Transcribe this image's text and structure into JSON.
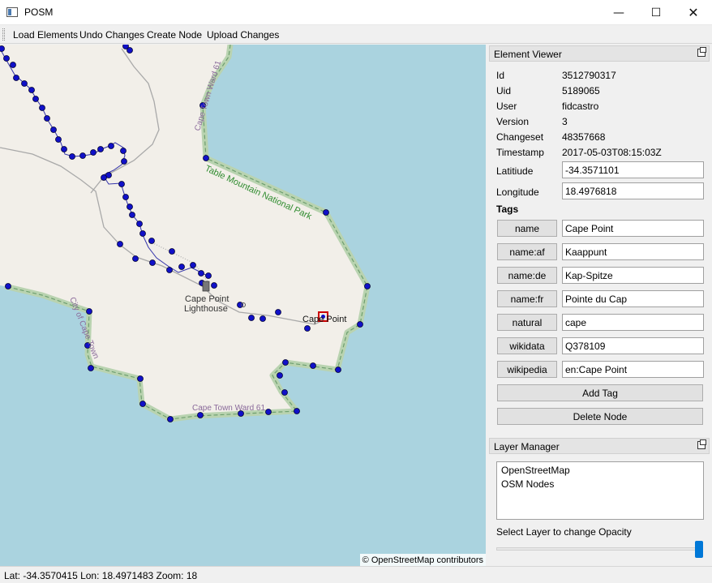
{
  "window": {
    "title": "POSM",
    "minimize_glyph": "—",
    "maximize_glyph": "☐",
    "close_glyph": "✕"
  },
  "toolbar": {
    "load_elements": "Load Elements",
    "undo_changes": "Undo Changes",
    "create_node": "Create Node",
    "upload_changes": "Upload Changes"
  },
  "map": {
    "labels": {
      "ward_top": "Cape Town Ward 61",
      "park": "Table Mountain National Park",
      "city": "City of Cape Town",
      "lighthouse_1": "Cape Point",
      "lighthouse_2": "Lighthouse",
      "cape_point": "Cape Point",
      "ward_bottom": "Cape Town Ward 61"
    },
    "attribution": "© OpenStreetMap contributors",
    "colors": {
      "sea": "#aad3df",
      "land": "#f2efe9",
      "boundary": "#8fbf8f",
      "node": "#0000cc",
      "selected": "#cc0000"
    }
  },
  "status": {
    "text": "Lat: -34.3570415 Lon: 18.4971483 Zoom: 18"
  },
  "element_viewer": {
    "title": "Element Viewer",
    "fields": {
      "id_label": "Id",
      "id_value": "3512790317",
      "uid_label": "Uid",
      "uid_value": "5189065",
      "user_label": "User",
      "user_value": "fidcastro",
      "version_label": "Version",
      "version_value": "3",
      "changeset_label": "Changeset",
      "changeset_value": "48357668",
      "timestamp_label": "Timestamp",
      "timestamp_value": "2017-05-03T08:15:03Z",
      "latitude_label": "Latitiude",
      "latitude_value": "-34.3571101",
      "longitude_label": "Longitude",
      "longitude_value": "18.4976818"
    },
    "tags_heading": "Tags",
    "tags": [
      {
        "key": "name",
        "value": "Cape Point"
      },
      {
        "key": "name:af",
        "value": "Kaappunt"
      },
      {
        "key": "name:de",
        "value": "Kap-Spitze"
      },
      {
        "key": "name:fr",
        "value": "Pointe du Cap"
      },
      {
        "key": "natural",
        "value": "cape"
      },
      {
        "key": "wikidata",
        "value": "Q378109"
      },
      {
        "key": "wikipedia",
        "value": "en:Cape Point"
      }
    ],
    "add_tag": "Add Tag",
    "delete_node": "Delete Node"
  },
  "layer_manager": {
    "title": "Layer Manager",
    "layers": [
      "OpenStreetMap",
      "OSM Nodes"
    ],
    "opacity_label": "Select Layer to change Opacity",
    "opacity": 1.0
  }
}
